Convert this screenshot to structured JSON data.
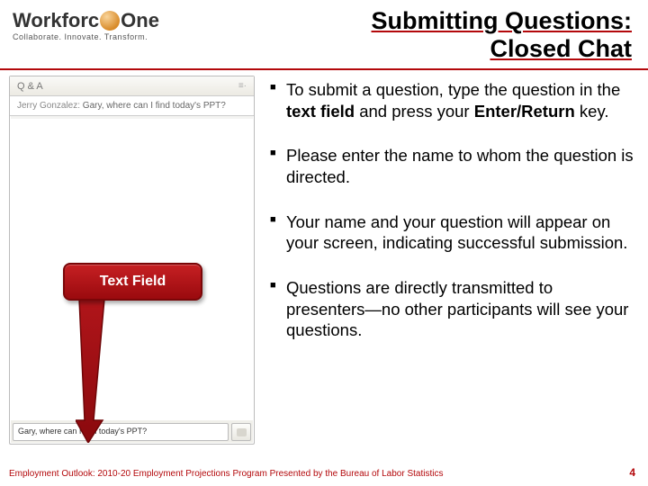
{
  "logo": {
    "part1": "Workforc",
    "part2": "One",
    "tagline": "Collaborate.  Innovate.  Transform."
  },
  "title": {
    "line1": "Submitting Questions:",
    "line2": "Closed Chat"
  },
  "qa_panel": {
    "header_label": "Q & A",
    "menu_glyph": "≡·",
    "message_author": "Jerry Gonzalez:",
    "message_text": " Gary, where can I find today's PPT?",
    "input_value": "Gary, where can I find today's PPT?"
  },
  "callout": {
    "label": "Text Field"
  },
  "bullets": {
    "b1_pre": "To submit a question, type the question in the ",
    "b1_bold1": "text field",
    "b1_mid": " and press your ",
    "b1_bold2": "Enter/Return",
    "b1_post": " key.",
    "b2": "Please enter the name to whom the question is directed.",
    "b3": "Your name and your question will appear on your screen, indicating successful submission.",
    "b4": "Questions are directly transmitted to presenters—no other participants will see your questions."
  },
  "footer": {
    "text": "Employment Outlook: 2010-20 Employment Projections Program Presented by the Bureau of Labor Statistics",
    "page": "4"
  }
}
